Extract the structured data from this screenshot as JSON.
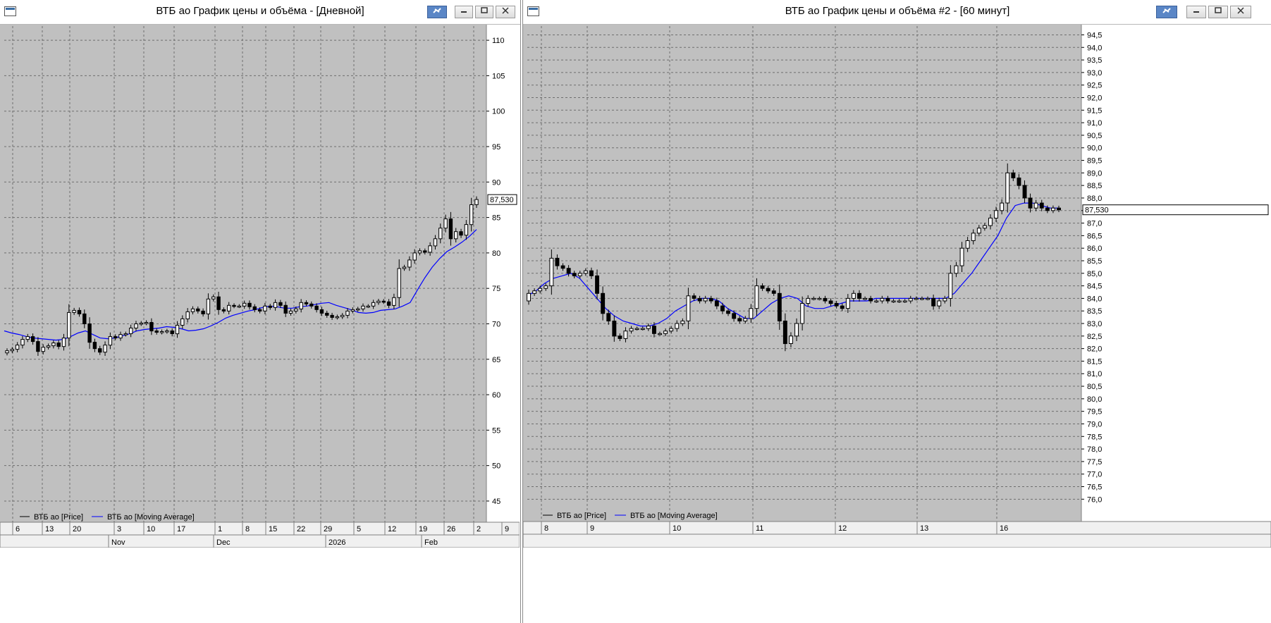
{
  "windows": [
    {
      "title": "ВТБ ао График цены и объёма - [Дневной]",
      "last_price_label": "87,530",
      "legend": [
        "ВТБ ао [Price]",
        "ВТБ ао [Moving Average]"
      ],
      "date_labels": [
        "6",
        "13",
        "20",
        "3",
        "10",
        "17",
        "1",
        "8",
        "15",
        "22",
        "29",
        "5",
        "12",
        "19",
        "26",
        "2",
        "9"
      ],
      "month_labels": [
        "Nov",
        "Dec",
        "2026",
        "Feb"
      ]
    },
    {
      "title": "ВТБ ао График цены и объёма #2 - [60 минут]",
      "last_price_label": "87,530",
      "legend": [
        "ВТБ ао [Price]",
        "ВТБ ао [Moving Average]"
      ],
      "date_labels": [
        "8",
        "9",
        "10",
        "11",
        "12",
        "13",
        "16"
      ],
      "month_labels": []
    }
  ],
  "icons": {
    "link": "link-icon",
    "minimize": "minimize-icon",
    "restore": "restore-icon",
    "close": "close-icon",
    "system": "window-menu-icon"
  },
  "colors": {
    "plot_bg": "#c0c0c0",
    "ma_line": "#0000ff",
    "candle": "#000000",
    "bull_fill": "#ffffff"
  },
  "chart_data": [
    {
      "type": "candlestick",
      "title": "",
      "y_axis_labels": [
        "110",
        "105",
        "100",
        "95",
        "90",
        "85",
        "80",
        "75",
        "70",
        "65",
        "60",
        "55",
        "50",
        "45"
      ],
      "ylim": [
        44,
        112
      ],
      "x_axis": [
        "6",
        "13",
        "20",
        "3",
        "10",
        "17",
        "1",
        "8",
        "15",
        "22",
        "29",
        "5",
        "12",
        "19",
        "26",
        "2",
        "9"
      ],
      "series": [
        {
          "name": "ВТБ ао [Price]",
          "close": [
            66.2,
            66.4,
            67.0,
            67.8,
            68.2,
            67.5,
            66.1,
            66.7,
            66.9,
            67.3,
            66.8,
            68.0,
            71.6,
            71.9,
            71.4,
            70.0,
            67.4,
            66.5,
            66.0,
            67.0,
            68.2,
            68.0,
            68.5,
            68.6,
            69.4,
            70.0,
            70.1,
            70.2,
            69.0,
            68.8,
            68.9,
            69.0,
            68.6,
            69.8,
            70.7,
            71.7,
            72.1,
            71.8,
            71.4,
            73.5,
            73.8,
            72.0,
            71.8,
            72.6,
            72.5,
            72.5,
            72.9,
            72.4,
            72.0,
            71.8,
            72.5,
            72.3,
            73.0,
            72.6,
            71.5,
            71.8,
            72.1,
            73.0,
            72.8,
            72.5,
            72.0,
            71.5,
            71.2,
            70.9,
            71.0,
            71.2,
            71.8,
            72.0,
            72.1,
            72.5,
            72.5,
            73.0,
            73.2,
            73.1,
            72.6,
            73.7,
            77.8,
            78.0,
            79.0,
            80.0,
            80.3,
            80.1,
            81.0,
            82.0,
            83.5,
            84.8,
            82.0,
            83.0,
            82.5,
            84.0,
            86.8,
            87.53
          ]
        },
        {
          "name": "ВТБ ао [Moving Average]",
          "values": [
            69.0,
            68.7,
            68.5,
            68.2,
            68.0,
            67.9,
            67.8,
            67.7,
            67.8,
            68.2,
            68.7,
            69.0,
            68.5,
            68.0,
            67.9,
            68.0,
            68.3,
            68.6,
            69.0,
            69.2,
            69.3,
            69.4,
            69.6,
            69.5,
            69.3,
            69.0,
            69.1,
            69.3,
            69.7,
            70.2,
            70.8,
            71.2,
            71.5,
            71.8,
            72.0,
            72.3,
            72.5,
            72.4,
            72.2,
            72.2,
            72.4,
            72.5,
            72.7,
            72.9,
            73.0,
            72.6,
            72.3,
            72.0,
            71.6,
            71.5,
            71.6,
            71.9,
            72.0,
            72.1,
            72.5,
            73.0,
            74.8,
            76.5,
            78.0,
            79.2,
            80.2,
            80.8,
            81.5,
            82.3,
            83.3
          ]
        }
      ]
    },
    {
      "type": "candlestick",
      "title": "",
      "y_axis_labels": [
        "94,5",
        "94,0",
        "93,5",
        "93,0",
        "92,5",
        "92,0",
        "91,5",
        "91,0",
        "90,5",
        "90,0",
        "89,5",
        "89,0",
        "88,5",
        "88,0",
        "87,5",
        "87,0",
        "86,5",
        "86,0",
        "85,5",
        "85,0",
        "84,5",
        "84,0",
        "83,5",
        "83,0",
        "82,5",
        "82,0",
        "81,5",
        "81,0",
        "80,5",
        "80,0",
        "79,5",
        "79,0",
        "78,5",
        "78,0",
        "77,5",
        "77,0",
        "76,5",
        "76,0"
      ],
      "ylim": [
        75.7,
        94.85
      ],
      "x_axis": [
        "8",
        "9",
        "10",
        "11",
        "12",
        "13",
        "16"
      ],
      "series": [
        {
          "name": "ВТБ ао [Price]",
          "close": [
            84.2,
            84.3,
            84.4,
            84.5,
            85.6,
            85.3,
            85.2,
            85.0,
            84.9,
            85.0,
            85.1,
            84.9,
            84.2,
            83.4,
            83.1,
            82.5,
            82.4,
            82.7,
            82.8,
            82.8,
            82.8,
            82.9,
            82.6,
            82.6,
            82.7,
            82.8,
            83.0,
            83.1,
            84.1,
            84.0,
            83.9,
            84.0,
            83.9,
            83.7,
            83.5,
            83.4,
            83.2,
            83.1,
            83.2,
            83.6,
            84.5,
            84.4,
            84.3,
            84.2,
            83.1,
            82.2,
            82.5,
            83.0,
            83.8,
            84.0,
            84.0,
            84.0,
            83.9,
            83.8,
            83.7,
            83.6,
            84.0,
            84.2,
            84.0,
            84.0,
            83.9,
            83.9,
            84.0,
            83.9,
            83.9,
            83.9,
            83.9,
            84.0,
            84.0,
            84.0,
            84.0,
            83.7,
            83.9,
            84.0,
            85.0,
            85.3,
            86.0,
            86.3,
            86.6,
            86.8,
            86.9,
            87.2,
            87.5,
            87.8,
            89.0,
            88.8,
            88.5,
            88.0,
            87.6,
            87.8,
            87.6,
            87.5,
            87.6,
            87.53
          ]
        },
        {
          "name": "ВТБ ао [Moving Average]",
          "values": [
            84.1,
            84.3,
            84.6,
            84.8,
            84.9,
            85.0,
            84.8,
            84.4,
            84.0,
            83.6,
            83.3,
            83.1,
            83.0,
            82.9,
            82.9,
            83.0,
            83.2,
            83.5,
            83.7,
            83.9,
            84.0,
            84.0,
            83.9,
            83.6,
            83.4,
            83.2,
            83.2,
            83.5,
            83.8,
            84.0,
            84.1,
            84.0,
            83.7,
            83.6,
            83.6,
            83.7,
            83.8,
            83.9,
            83.9,
            83.9,
            84.0,
            84.0,
            84.0,
            84.0,
            84.0,
            84.0,
            84.0,
            84.0,
            84.0,
            84.2,
            84.6,
            85.0,
            85.5,
            86.0,
            86.5,
            87.2,
            87.7,
            87.8,
            87.8,
            87.7,
            87.6,
            87.6
          ]
        }
      ]
    }
  ]
}
